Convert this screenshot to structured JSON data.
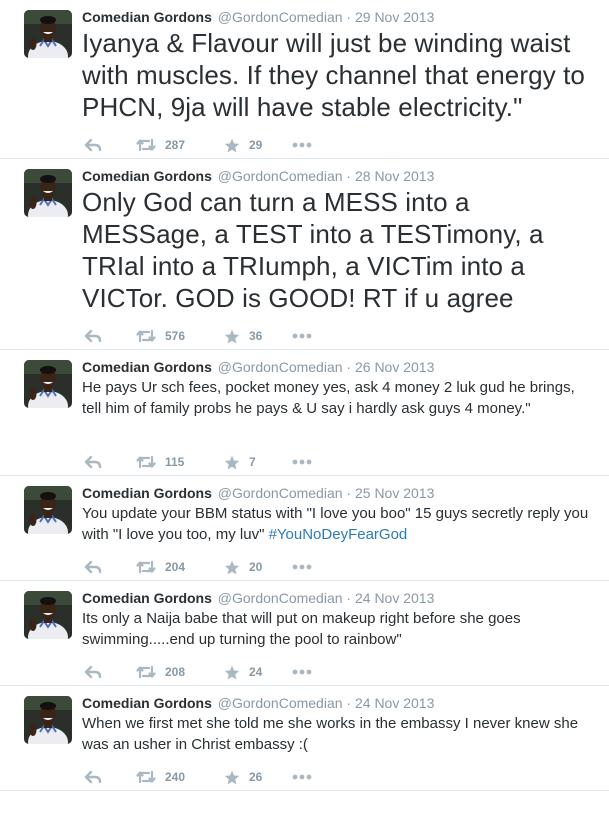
{
  "colors": {
    "text": "#292f33",
    "meta": "#8899a6",
    "link": "#2b7bb9",
    "divider": "#e1e8ed"
  },
  "icons": {
    "reply": "reply-icon",
    "retweet": "retweet-icon",
    "favorite": "star-icon",
    "more": "more-dots-icon"
  },
  "tweets": [
    {
      "name": "Comedian Gordons",
      "handle": "@GordonComedian",
      "sep": "·",
      "date": "29 Nov 2013",
      "text": "Iyanya & Flavour will just be winding waist with muscles. If they channel that energy to PHCN, 9ja will have stable electricity.\"",
      "retweets": "287",
      "favorites": "29"
    },
    {
      "name": "Comedian Gordons",
      "handle": "@GordonComedian",
      "sep": "·",
      "date": "28 Nov 2013",
      "text": "Only God can turn a MESS into a MESSage, a TEST into a TESTimony, a TRIal into a TRIumph, a VICTim into a VICTor. GOD is GOOD! RT if u agree",
      "retweets": "576",
      "favorites": "36"
    },
    {
      "name": "Comedian Gordons",
      "handle": "@GordonComedian",
      "sep": "·",
      "date": "26 Nov 2013",
      "text": "He pays Ur sch fees, pocket money yes, ask 4 money 2 luk gud he brings, tell him of family probs he pays & U say i hardly ask guys 4 money.\"",
      "retweets": "115",
      "favorites": "7"
    },
    {
      "name": "Comedian Gordons",
      "handle": "@GordonComedian",
      "sep": "·",
      "date": "25 Nov 2013",
      "text": "You update your BBM status with \"I love you boo\" 15 guys secretly reply you with \"I love you too, my luv\" ",
      "hashtag": "#YouNoDeyFearGod",
      "retweets": "204",
      "favorites": "20"
    },
    {
      "name": "Comedian Gordons",
      "handle": "@GordonComedian",
      "sep": "·",
      "date": "24 Nov 2013",
      "text": "Its only a Naija babe that will put on makeup right before she goes swimming.....end up turning the pool to rainbow\"",
      "retweets": "208",
      "favorites": "24"
    },
    {
      "name": "Comedian Gordons",
      "handle": "@GordonComedian",
      "sep": "·",
      "date": "24 Nov 2013",
      "text": "When we first met she told me she works  in the embassy I never knew she was an usher in Christ embassy :(",
      "retweets": "240",
      "favorites": "26"
    }
  ]
}
